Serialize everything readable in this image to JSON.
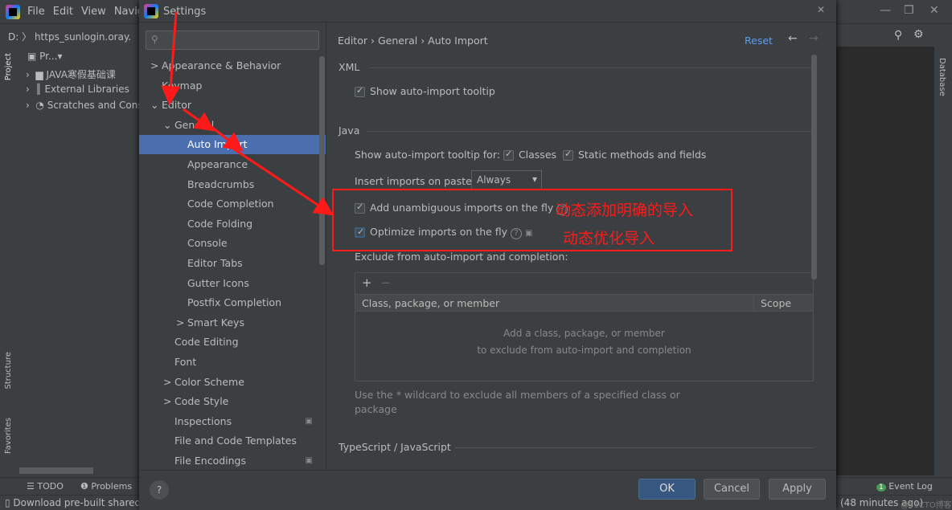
{
  "ide": {
    "menu": [
      "File",
      "Edit",
      "View",
      "Navig"
    ],
    "breadcrumb_drive": "D:",
    "breadcrumb_file": "https_sunlogin.oray.",
    "project_dropdown": "Pr...",
    "project_items": [
      "JAVA寒假基础课",
      "External Libraries",
      "Scratches and Cons"
    ],
    "left_tabs": [
      "Project",
      "Structure",
      "Favorites"
    ],
    "right_tab": "Database",
    "bottom_tabs": [
      "TODO",
      "Problems"
    ],
    "event_log": "Event Log",
    "event_count": "1",
    "status_left": "Download pre-built shared",
    "status_right": "(48 minutes ago)",
    "watermark": "@51CTO博客"
  },
  "dialog": {
    "title": "Settings",
    "search_placeholder": "",
    "tree": [
      {
        "label": "Appearance & Behavior",
        "level": 0,
        "expand": ">"
      },
      {
        "label": "Keymap",
        "level": 0,
        "expand": ""
      },
      {
        "label": "Editor",
        "level": 0,
        "expand": "v"
      },
      {
        "label": "General",
        "level": 1,
        "expand": "v"
      },
      {
        "label": "Auto Import",
        "level": 2,
        "expand": "",
        "selected": true
      },
      {
        "label": "Appearance",
        "level": 2,
        "expand": ""
      },
      {
        "label": "Breadcrumbs",
        "level": 2,
        "expand": ""
      },
      {
        "label": "Code Completion",
        "level": 2,
        "expand": ""
      },
      {
        "label": "Code Folding",
        "level": 2,
        "expand": ""
      },
      {
        "label": "Console",
        "level": 2,
        "expand": ""
      },
      {
        "label": "Editor Tabs",
        "level": 2,
        "expand": ""
      },
      {
        "label": "Gutter Icons",
        "level": 2,
        "expand": ""
      },
      {
        "label": "Postfix Completion",
        "level": 2,
        "expand": ""
      },
      {
        "label": "Smart Keys",
        "level": 2,
        "expand": ">"
      },
      {
        "label": "Code Editing",
        "level": 1,
        "expand": ""
      },
      {
        "label": "Font",
        "level": 1,
        "expand": ""
      },
      {
        "label": "Color Scheme",
        "level": 1,
        "expand": ">"
      },
      {
        "label": "Code Style",
        "level": 1,
        "expand": ">"
      },
      {
        "label": "Inspections",
        "level": 1,
        "expand": "",
        "badge": true
      },
      {
        "label": "File and Code Templates",
        "level": 1,
        "expand": ""
      },
      {
        "label": "File Encodings",
        "level": 1,
        "expand": "",
        "badge": true
      }
    ],
    "breadcrumb": [
      "Editor",
      "General",
      "Auto Import"
    ],
    "reset": "Reset",
    "xml_section": "XML",
    "xml_tooltip": "Show auto-import tooltip",
    "java_section": "Java",
    "java_tooltip_for": "Show auto-import tooltip for:",
    "classes": "Classes",
    "static_methods": "Static methods and fields",
    "insert_on_paste": "Insert imports on paste:",
    "insert_value": "Always",
    "add_unambiguous": "Add unambiguous imports on the fly",
    "optimize": "Optimize imports on the fly",
    "exclude_label": "Exclude from auto-import and completion:",
    "table_headers": [
      "Class, package, or member",
      "Scope"
    ],
    "empty_line1": "Add a class, package, or member",
    "empty_line2": "to exclude from auto-import and completion",
    "wildcard_hint_1": "Use the * wildcard to exclude all members of a specified class or",
    "wildcard_hint_2": "package",
    "ts_section": "TypeScript / JavaScript",
    "ok": "OK",
    "cancel": "Cancel",
    "apply": "Apply",
    "help": "?"
  },
  "annotations": {
    "note1": "动态添加明确的导入",
    "note2": "动态优化导入",
    "color": "#ff1a1a"
  }
}
